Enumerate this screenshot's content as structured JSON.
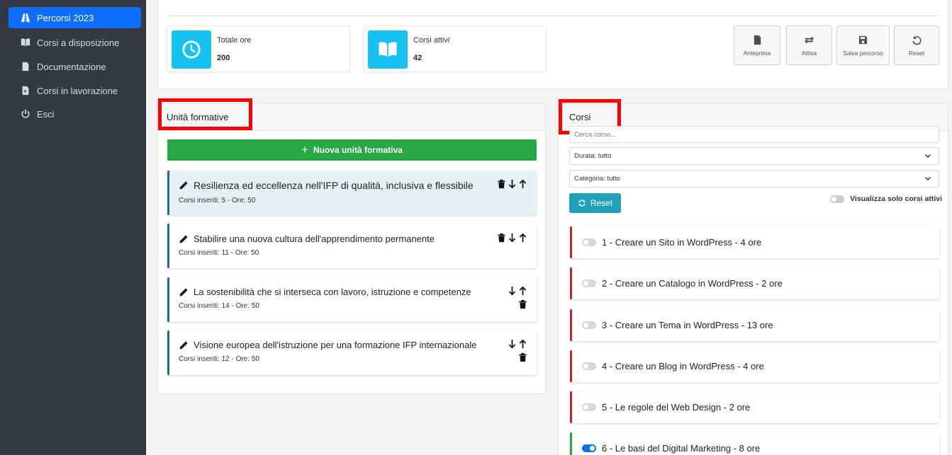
{
  "sidebar": {
    "items": [
      {
        "label": "Percorsi 2023",
        "icon": "road-icon",
        "active": true
      },
      {
        "label": "Corsi a disposizione",
        "icon": "book-icon",
        "active": false
      },
      {
        "label": "Documentazione",
        "icon": "pdf-file-icon",
        "active": false
      },
      {
        "label": "Corsi in lavorazione",
        "icon": "excel-file-icon",
        "active": false
      },
      {
        "label": "Esci",
        "icon": "power-icon",
        "active": false
      }
    ]
  },
  "stats": {
    "hours": {
      "label": "Totale ore",
      "value": "200",
      "icon": "clock-icon"
    },
    "courses": {
      "label": "Corsi attivi",
      "value": "42",
      "icon": "open-book-icon"
    }
  },
  "toolbar": {
    "preview": "Anteprima",
    "activate": "Attiva",
    "save": "Salva percorso",
    "reset": "Reset"
  },
  "units_panel": {
    "title": "Unità formative",
    "new_button": "Nuova unità formativa",
    "units": [
      {
        "title": "Resilienza ed eccellenza nell'IFP di qualità, inclusiva e flessibile",
        "meta": "Corsi inseriti: 5 - Ore: 50"
      },
      {
        "title": "Stabilire una nuova cultura dell'apprendimento permanente",
        "meta": "Corsi inseriti: 11 - Ore: 50"
      },
      {
        "title": "La sostenibilità che si interseca con lavoro, istruzione e competenze",
        "meta": "Corsi inseriti: 14 - Ore: 50"
      },
      {
        "title": "Visione europea dell'istruzione per una formazione IFP internazionale",
        "meta": "Corsi inseriti: 12 - Ore: 50"
      }
    ]
  },
  "courses_panel": {
    "title": "Corsi",
    "search_placeholder": "Cerca corso...",
    "duration_filter": "Durata: tutto",
    "category_filter": "Categoria: tutto",
    "reset_button": "Reset",
    "only_active_label": "Visualizza solo corsi attivi",
    "courses": [
      {
        "label": "1 - Creare un Sito in WordPress - 4 ore",
        "active": false
      },
      {
        "label": "2 - Creare un Catalogo in WordPress - 2 ore",
        "active": false
      },
      {
        "label": "3 - Creare un Tema in WordPress - 13 ore",
        "active": false
      },
      {
        "label": "4 - Creare un Blog in WordPress - 4 ore",
        "active": false
      },
      {
        "label": "5 - Le regole del Web Design - 2 ore",
        "active": false
      },
      {
        "label": "6 - Le basi del Digital Marketing - 8 ore",
        "active": true
      }
    ]
  },
  "colors": {
    "sidebar_bg": "#343a40",
    "primary": "#0d6efd",
    "success": "#28a745",
    "info": "#17c1f0",
    "danger_border": "#c82333",
    "highlight_box": "#ff0000"
  }
}
